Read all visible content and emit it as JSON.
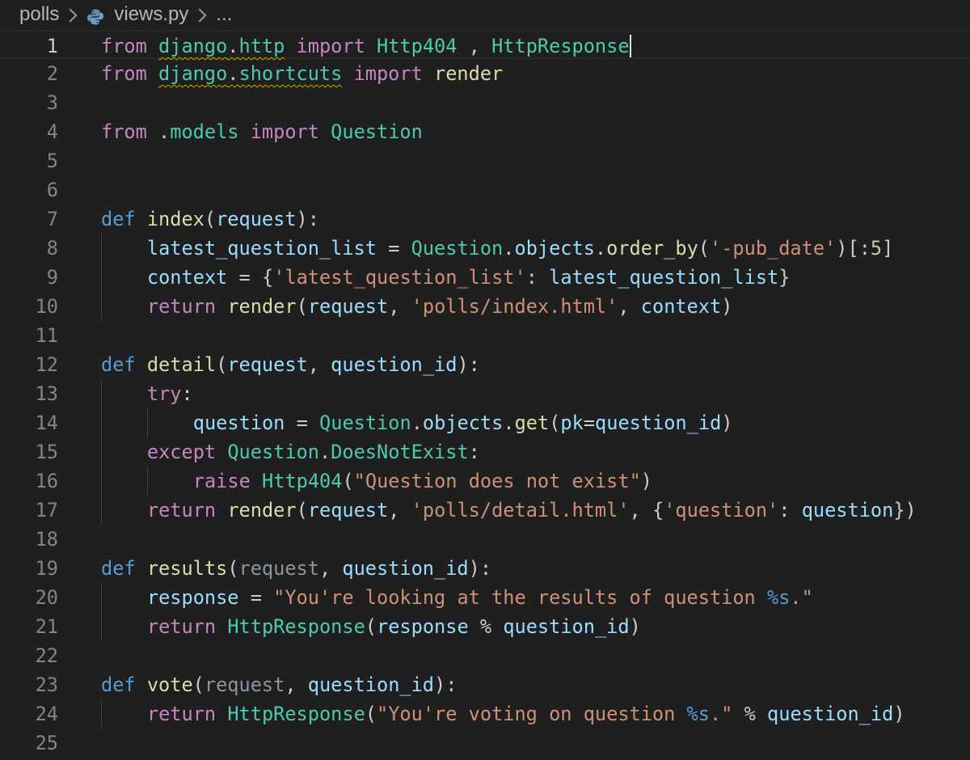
{
  "breadcrumb": {
    "folder": "polls",
    "file": "views.py",
    "more": "..."
  },
  "editor": {
    "active_line": 1,
    "lines": [
      "from django.http import Http404 , HttpResponse",
      "from django.shortcuts import render",
      "",
      "from .models import Question",
      "",
      "",
      "def index(request):",
      "    latest_question_list = Question.objects.order_by('-pub_date')[:5]",
      "    context = {'latest_question_list': latest_question_list}",
      "    return render(request, 'polls/index.html', context)",
      "",
      "def detail(request, question_id):",
      "    try:",
      "        question = Question.objects.get(pk=question_id)",
      "    except Question.DoesNotExist:",
      "        raise Http404(\"Question does not exist\")",
      "    return render(request, 'polls/detail.html', {'question': question})",
      "",
      "def results(request, question_id):",
      "    response = \"You're looking at the results of question %s.\"",
      "    return HttpResponse(response % question_id)",
      "",
      "def vote(request, question_id):",
      "    return HttpResponse(\"You're voting on question %s.\" % question_id)",
      ""
    ]
  },
  "icons": {
    "file_icon": "python-file-icon",
    "separator": "chevron-right-icon"
  },
  "colors": {
    "background": "#1f1f1f",
    "keyword_control": "#c586c0",
    "keyword_def": "#569cd6",
    "function": "#dcdcaa",
    "class": "#4ec9b0",
    "variable": "#9cdcfe",
    "string": "#ce9178",
    "number": "#b5cea8",
    "line_number": "#858585",
    "warning_squiggle": "#cca700"
  }
}
